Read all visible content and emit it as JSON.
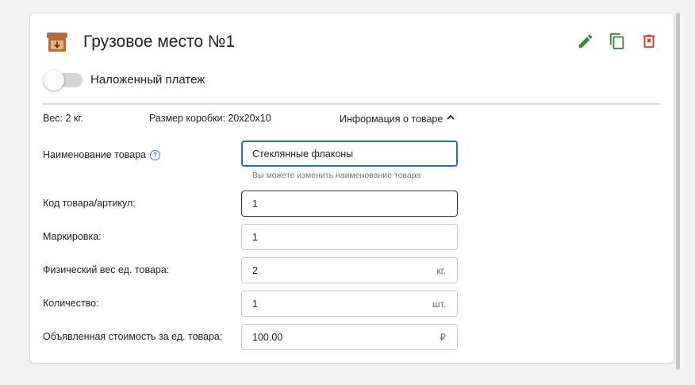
{
  "card": {
    "title": "Грузовое место №1",
    "icons": [
      "archive-box-icon",
      "pencil-icon",
      "copy-icon",
      "delete-icon"
    ],
    "colors": {
      "edit": "#2e8b3e",
      "copy": "#2e8b3e",
      "delete": "#d32f2f",
      "box": "#b36b3a"
    }
  },
  "cod": {
    "label": "Наложенный платеж",
    "enabled": false
  },
  "summary": {
    "weight": "Вес: 2 кг.",
    "box_size": "Размер коробки: 20х20х10",
    "product_info": "Информация о товаре"
  },
  "fields": {
    "name": {
      "label": "Наименование товара",
      "value": "Стеклянные флаконы",
      "hint": "Вы можете изменить наименование товара"
    },
    "sku": {
      "label": "Код товара/артикул:",
      "value": "1"
    },
    "marking": {
      "label": "Маркировка:",
      "value": "1"
    },
    "weight": {
      "label": "Физический вес ед. товара:",
      "value": "2",
      "unit": "кг."
    },
    "quantity": {
      "label": "Количество:",
      "value": "1",
      "unit": "шт."
    },
    "price": {
      "label": "Объявленная стоимость за ед. товара:",
      "value": "100.00",
      "unit": "₽"
    }
  }
}
